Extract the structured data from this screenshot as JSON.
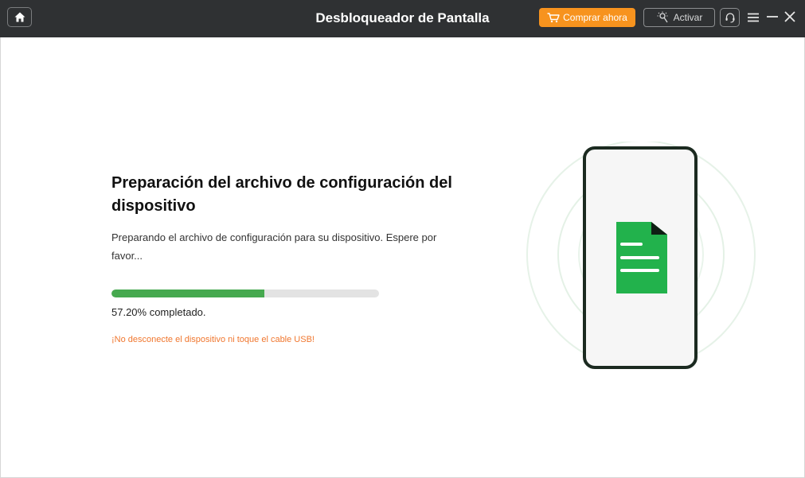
{
  "header": {
    "title": "Desbloqueador de Pantalla",
    "buy_label": "Comprar ahora",
    "activate_label": "Activar"
  },
  "main": {
    "heading": "Preparación del archivo de configuración del dispositivo",
    "description": "Preparando el archivo de configuración para su dispositivo. Espere por favor...",
    "progress_fraction": 0.572,
    "progress_text": "57.20% completado.",
    "warning": "¡No desconecte el dispositivo ni toque el cable USB!"
  },
  "icons": [
    "home-icon",
    "cart-icon",
    "key-icon",
    "headset-icon",
    "menu-icon",
    "minimize-icon",
    "close-icon",
    "phone-illustration",
    "document-icon"
  ],
  "colors": {
    "titlebar": "#2f3133",
    "accent_orange": "#f7931e",
    "progress_green": "#46a94f",
    "progress_track": "#e3e3e3",
    "warning_text": "#f0772f",
    "phone_frame": "#1b2a20",
    "document_green": "#22b24c"
  }
}
